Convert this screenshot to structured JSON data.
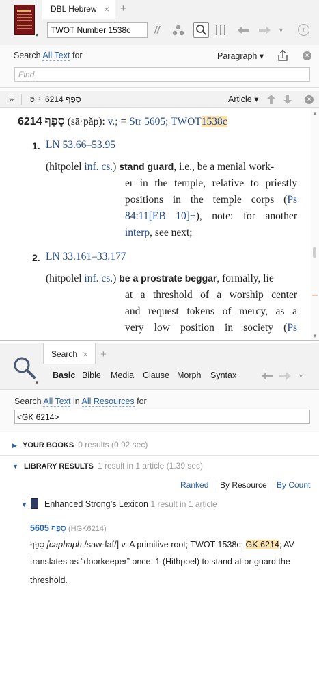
{
  "top_window": {
    "tab_label": "DBL Hebrew",
    "tab_close": "×",
    "tab_add": "+",
    "reference_value": "TWOT Number 1538c",
    "toolbar_icons": [
      "parallel-resources-icon",
      "visual-filters-icon",
      "search-icon",
      "columns-icon",
      "back-icon",
      "forward-icon",
      "history-dropdown-icon",
      "info-icon"
    ],
    "info_glyph": "i"
  },
  "find_bar": {
    "search_prefix": "Search",
    "scope": "All Text",
    "for": "for",
    "paragraph_label": "Paragraph ▾",
    "find_placeholder": "Find"
  },
  "nav_bar": {
    "chevrons": "»",
    "crumb_letter": "ס",
    "crumb_entry": "6214 סָפַף",
    "article_label": "Article ▾"
  },
  "entry": {
    "number": "6214",
    "hebrew": "סָפַף",
    "translit": "(sā·păp)",
    "pos": "v.;",
    "equiv": "≡",
    "strongs": "Str 5605;",
    "twot": "TWOT",
    "twot_num": "1538c",
    "senses": [
      {
        "num": "1.",
        "ln": "LN 53.66–53.95",
        "open_paren": "(hitpolel",
        "gram": "inf. cs.",
        "close_paren": ")",
        "gloss": "stand guard",
        "line1_rest": ", i.e., be a menial work-",
        "line2": "er in the temple, relative to priestly",
        "line3": "positions in the temple corps",
        "line3_paren": "(",
        "ref": "Ps",
        "line4_ref": "84:11",
        "line4_ref2": "[EB 10]",
        "line4_plus": "+",
        "line4_rest": "), note: for another",
        "line5_link": "interp",
        "line5_rest": ", see next;"
      },
      {
        "num": "2.",
        "ln": "LN 33.161–33.177",
        "open_paren": "(hitpolel",
        "gram": "inf. cs.",
        "close_paren": ")",
        "gloss": "be a prostrate beggar",
        "line1_rest": ", formally, lie",
        "line2": "at a threshold of a worship center",
        "line3": "and request tokens of mercy, as a",
        "line4": "very low position in society (",
        "line4_ref": "Ps"
      }
    ]
  },
  "search_window": {
    "tab_label": "Search",
    "tab_close": "×",
    "tab_add": "+",
    "modes": [
      "Basic",
      "Bible",
      "Media",
      "Clause",
      "Morph",
      "Syntax"
    ],
    "search_prefix": "Search",
    "scope": "All Text",
    "in": "in",
    "resources": "All Resources",
    "for": "for",
    "query": "<GK 6214>",
    "your_books_label": "YOUR BOOKS",
    "your_books_meta": "0 results (0.92 sec)",
    "library_label": "LIBRARY RESULTS",
    "library_meta": "1 result in 1 article (1.39 sec)",
    "sort_options": [
      "Ranked",
      "By Resource",
      "By Count"
    ],
    "result_book": "Enhanced Strong’s Lexicon",
    "result_book_meta": "1 result in 1 article",
    "result": {
      "number": "5605",
      "hebrew": "סָפַף",
      "gk": "(HGK6214)",
      "line1_heb": "סָפַף",
      "line1_translit": "[caphaph",
      "line1_pron": " /saw·faf/] v. A primitive root; TWOT 1538c; ",
      "line1_gk": "GK 6214",
      "line1_end": "; AV",
      "line2": "translates as “doorkeeper” once. 1 (Hithpoel) to stand at or guard the",
      "line3": "threshold."
    }
  },
  "colors": {
    "link": "#234b8c",
    "highlight": "#fbe3b1",
    "chrome": "#f2f2f2"
  }
}
